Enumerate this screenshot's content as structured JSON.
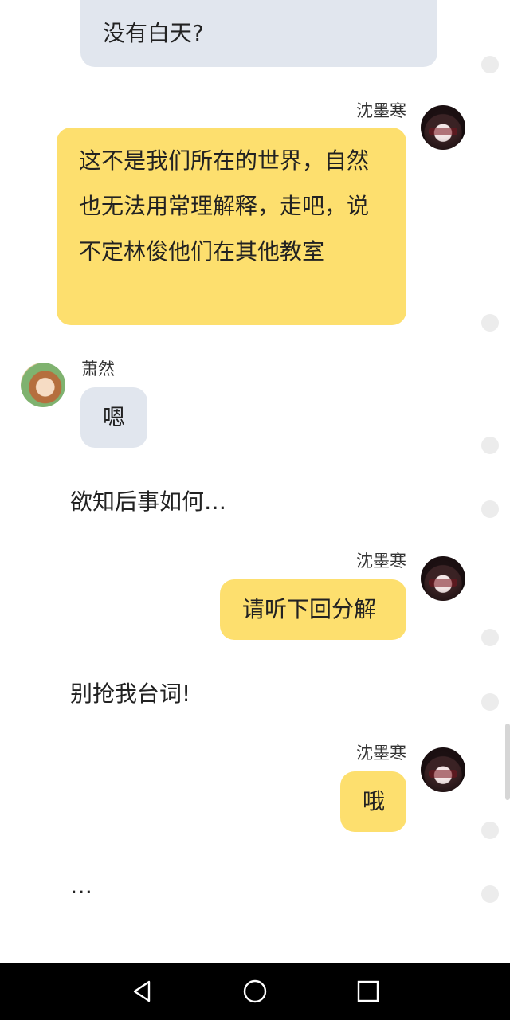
{
  "messages": [
    {
      "speaker": "",
      "text": "没有白天?"
    },
    {
      "speaker": "沈墨寒",
      "text": "这不是我们所在的世界，自然也无法用常理解释，走吧，说不定林俊他们在其他教室"
    },
    {
      "speaker": "萧然",
      "text": "嗯"
    },
    {
      "narration": "欲知后事如何…"
    },
    {
      "speaker": "沈墨寒",
      "text": "请听下回分解"
    },
    {
      "narration": "别抢我台词!"
    },
    {
      "speaker": "沈墨寒",
      "text": "哦"
    },
    {
      "narration": "…"
    }
  ],
  "avatars": {
    "shen": "dark-haired-character-avatar",
    "xiao": "brown-haired-character-avatar"
  },
  "colors": {
    "incoming_bubble": "#e1e6ee",
    "outgoing_bubble": "#fddf6e",
    "nav_bar": "#000000"
  },
  "nav": {
    "back_icon": "triangle-back-icon",
    "home_icon": "circle-home-icon",
    "recents_icon": "square-recents-icon"
  }
}
